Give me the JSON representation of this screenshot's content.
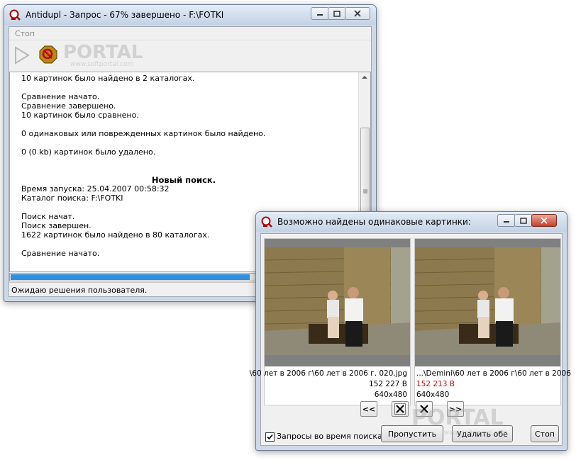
{
  "main_window": {
    "title": "Antidupl - Запрос - 67% завершено - F:\\FOTKI",
    "menu": {
      "stop": "Стоп"
    },
    "log_lines": [
      "10 картинок было найдено в 2 каталогах.",
      "",
      "Сравнение начато.",
      "Сравнение завершено.",
      "10 картинок было сравнено.",
      "",
      "0 одинаковых или поврежденных картинок было найдено.",
      "",
      "0 (0 kb) картинок было удалено.",
      "",
      "",
      "Новый поиск.",
      "Время запуска: 25.04.2007 00:58:32",
      "Каталог поиска: F:\\FOTKI",
      "",
      "Поиск начат.",
      "Поиск завершен.",
      "1622 картинок было найдено в 80 каталогах.",
      "",
      "Сравнение начато."
    ],
    "progress": 0.67,
    "status": "Ожидаю решения пользователя."
  },
  "dialog": {
    "title": "Возможно найдены одинаковые картинки:",
    "left": {
      "path": "\\60 лет в 2006 г\\60 лет в 2006 г. 020.jpg",
      "size": "152 227 B",
      "dims": "640x480"
    },
    "right": {
      "path": "...\\Demini\\60 лет в 2006 г\\60 лет в 2006",
      "size": "152 213 B",
      "dims": "640x480"
    },
    "nav": {
      "prev": "<<",
      "next": ">>"
    },
    "checkbox_label": "Запросы во время поиска",
    "checkbox_checked": true,
    "buttons": {
      "skip": "Пропустить",
      "delete_both": "Удалить обе",
      "stop": "Стоп"
    }
  },
  "watermark": {
    "portal": "PORTAL",
    "url": "www.softportal.com"
  },
  "colors": {
    "size_diff": "#cc0000",
    "progress": "#2f8fe0"
  }
}
